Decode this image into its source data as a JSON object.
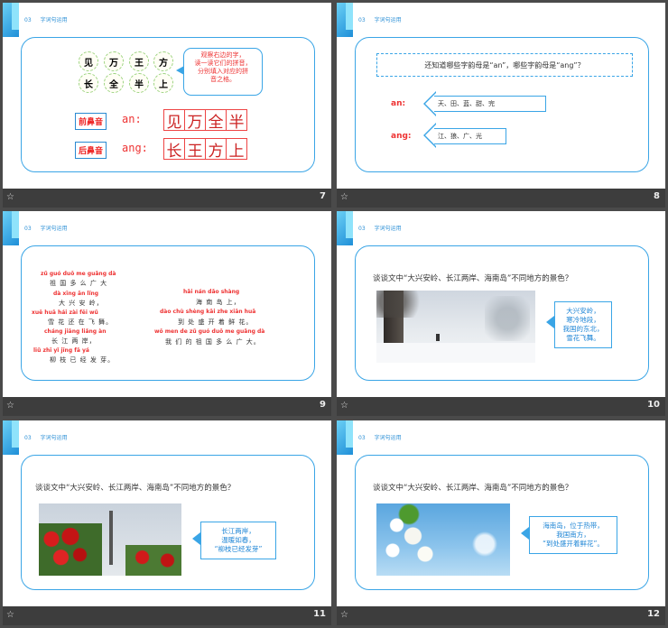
{
  "header": {
    "section_number": "03",
    "section_title": "字词句运用"
  },
  "slides": {
    "s7": {
      "number": "7",
      "chars_top": [
        "见",
        "万",
        "王",
        "方"
      ],
      "chars_bottom": [
        "长",
        "全",
        "半",
        "上"
      ],
      "callout": [
        "观察右边的字，",
        "读一读它们的拼音，",
        "分别填入对应的拼",
        "音之格。"
      ],
      "qianbiyin": "前鼻音",
      "houbiyin": "后鼻音",
      "an_label": "an:",
      "ang_label": "ang:",
      "an_chars": [
        "见",
        "万",
        "全",
        "半"
      ],
      "ang_chars": [
        "长",
        "王",
        "方",
        "上"
      ]
    },
    "s8": {
      "number": "8",
      "question": "还知道哪些字韵母是“an”，哪些字韵母是“ang”？",
      "an_label": "an:",
      "ang_label": "ang:",
      "an_words": "天、田、蓝、甜、完",
      "ang_words": "江、狼、广、光"
    },
    "s9": {
      "number": "9",
      "left": [
        {
          "py": "zǔ guó duō me guǎng dà",
          "hz": "祖 国 多 么 广 大"
        },
        {
          "py": "dà xīng ān lǐng",
          "hz": "大 兴 安 岭，"
        },
        {
          "py": "xuě huā hái zài fēi wǔ",
          "hz": "雪 花 还 在 飞 舞。"
        },
        {
          "py": "cháng jiāng liǎng àn",
          "hz": "长 江 两 岸，"
        },
        {
          "py": "liǔ zhī yǐ jīng fā yá",
          "hz": "柳 枝 已 经 发 芽。"
        }
      ],
      "right": [
        {
          "py": "hǎi nán dǎo shàng",
          "hz": "海 南 岛 上，"
        },
        {
          "py": "dào chù shèng kāi zhe xiān huā",
          "hz": "到 处 盛 开 着 鲜 花。"
        },
        {
          "py": "wǒ men de zǔ guó duō me guǎng dà",
          "hz": "我 们 的 祖 国 多 么 广 大。"
        }
      ]
    },
    "s10": {
      "number": "10",
      "question": "谈谈文中“大兴安岭、长江两岸、海南岛”不同地方的景色？",
      "note": [
        "大兴安岭，",
        "寒冷地段，",
        "我国的东北，",
        "雪花飞舞。"
      ]
    },
    "s11": {
      "number": "11",
      "question": "谈谈文中“大兴安岭、长江两岸、海南岛”不同地方的景色？",
      "note": [
        "长江两岸，",
        "温暖如春，",
        "“柳枝已经发芽”"
      ]
    },
    "s12": {
      "number": "12",
      "question": "谈谈文中“大兴安岭、长江两岸、海南岛”不同地方的景色？",
      "note": [
        "海南岛，位于热带，",
        "我国南方，",
        "“到处盛开着鲜花”。"
      ]
    }
  },
  "icons": {
    "note": "star-icon",
    "accent": "#3aa5e6",
    "red": "#e33333"
  }
}
